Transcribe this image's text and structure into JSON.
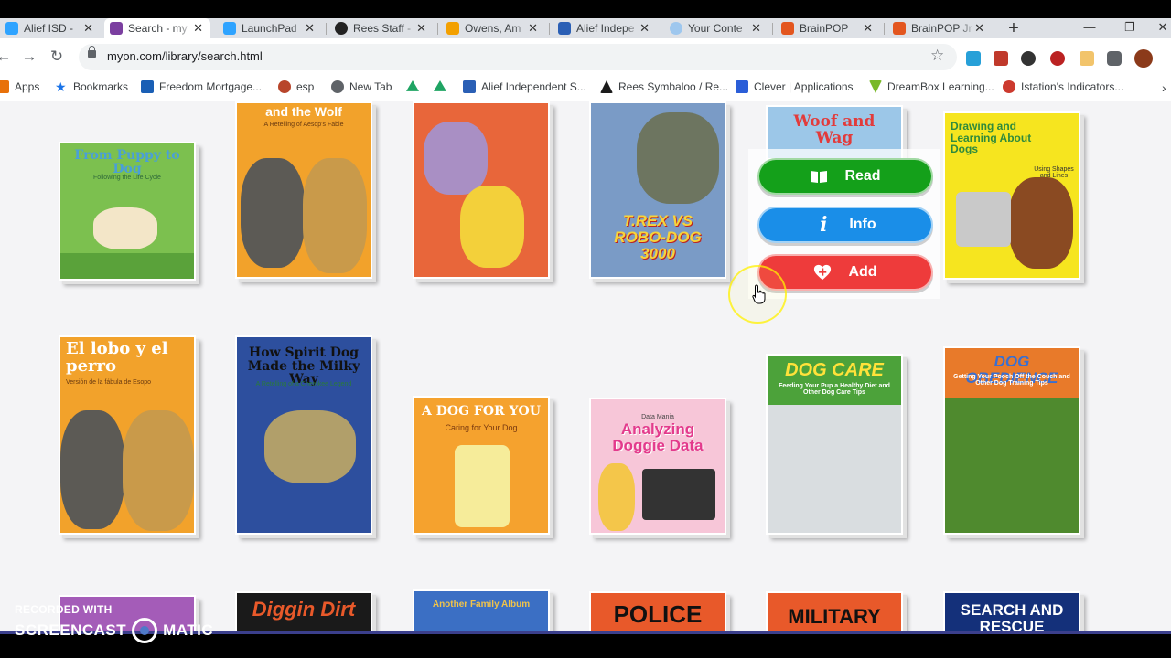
{
  "tabs": [
    {
      "title": "Alief ISD - ",
      "color": "#2ea3ff",
      "active": false
    },
    {
      "title": "Search - my",
      "color": "#7b3fa0",
      "active": true
    },
    {
      "title": "LaunchPad",
      "color": "#2ea3ff",
      "active": false
    },
    {
      "title": "Rees Staff -",
      "color": "#222222",
      "active": false
    },
    {
      "title": "Owens, Am",
      "color": "#f3a000",
      "active": false
    },
    {
      "title": "Alief Indepe",
      "color": "#2a5fb5",
      "active": false
    },
    {
      "title": "Your Conte",
      "color": "#9ec7ee",
      "active": false
    },
    {
      "title": "BrainPOP",
      "color": "#e3561f",
      "active": false
    },
    {
      "title": "BrainPOP Jr",
      "color": "#e3561f",
      "active": false
    }
  ],
  "address": {
    "url": "myon.com/library/search.html"
  },
  "bookmarks": [
    {
      "label": "Apps",
      "color": "#e8710a"
    },
    {
      "label": "Bookmarks",
      "color": "#1a73e8"
    },
    {
      "label": "Freedom Mortgage...",
      "color": "#1a5fb5"
    },
    {
      "label": "esp",
      "color": "#b8452b"
    },
    {
      "label": "New Tab",
      "color": "#5f6368"
    },
    {
      "label": "",
      "color": "#1fa463"
    },
    {
      "label": "Alief Independent S...",
      "color": "#2a5fb5"
    },
    {
      "label": "Rees Symbaloo / Re...",
      "color": "#1b1b1b"
    },
    {
      "label": "Clever | Applications",
      "color": "#2b5ed8"
    },
    {
      "label": "DreamBox Learning...",
      "color": "#79b928"
    },
    {
      "label": "Istation's Indicators...",
      "color": "#cc3a2e"
    }
  ],
  "books": [
    {
      "title": "From Puppy to Dog",
      "subtitle": "Following the Life Cycle",
      "bg": "#7cc04f",
      "tc": "#4a9fd8"
    },
    {
      "title": "and the Wolf",
      "subtitle": "A Retelling of Aesop's Fable",
      "bg": "#f2a22b",
      "tc": "#ffffff"
    },
    {
      "title": "",
      "subtitle": "",
      "bg": "#e8663a",
      "tc": "#ffffff"
    },
    {
      "title": "T.REX VS ROBO-DOG 3000",
      "subtitle": "",
      "bg": "#7a9bc6",
      "tc": "#f7d43a"
    },
    {
      "title": "Woof and Wag",
      "subtitle": "",
      "bg": "#9cc7e8",
      "tc": "#e23b3b"
    },
    {
      "title": "Drawing and Learning About Dogs",
      "subtitle": "Using Shapes and Lines",
      "bg": "#f6e51f",
      "tc": "#2f8a3c"
    },
    {
      "title": "El lobo y el perro",
      "subtitle": "Versión de la fábula de Esopo",
      "bg": "#f2a22b",
      "tc": "#ffffff"
    },
    {
      "title": "How Spirit Dog Made the Milky Way",
      "subtitle": "A Retelling of a Cherokee Legend",
      "bg": "#2d4f9e",
      "tc": "#111111"
    },
    {
      "title": "A DOG FOR YOU",
      "subtitle": "Caring for Your Dog",
      "bg": "#f5a22e",
      "tc": "#ffffff"
    },
    {
      "title": "Analyzing Doggie Data",
      "subtitle": "Data Mania",
      "bg": "#f7c6d8",
      "tc": "#e33a8c"
    },
    {
      "title": "DOG CARE",
      "subtitle": "Feeding Your Pup a Healthy Diet and Other Dog Care Tips",
      "bg": "#4ca23a",
      "tc": "#ffe23a"
    },
    {
      "title": "DOG OBEDIENCE",
      "subtitle": "Getting Your Pooch Off the Couch and Other Dog Training Tips",
      "bg": "#e87a2a",
      "tc": "#3a6fd0"
    },
    {
      "title": "",
      "subtitle": "",
      "bg": "#a45cb8",
      "tc": "#f7d43a"
    },
    {
      "title": "Diggin Dirt",
      "subtitle": "",
      "bg": "#1a1a1a",
      "tc": "#e8592a"
    },
    {
      "title": "Another Family Album",
      "subtitle": "",
      "bg": "#3b6fc4",
      "tc": "#f0c34a"
    },
    {
      "title": "POLICE",
      "subtitle": "",
      "bg": "#e8592a",
      "tc": "#111111"
    },
    {
      "title": "MILITARY",
      "subtitle": "",
      "bg": "#e8592a",
      "tc": "#111111"
    },
    {
      "title": "SEARCH AND RESCUE",
      "subtitle": "",
      "bg": "#14307a",
      "tc": "#ffffff"
    }
  ],
  "actions": {
    "read": {
      "label": "Read",
      "color": "#14a01a"
    },
    "info": {
      "label": "Info",
      "color": "#1a8ee8"
    },
    "add": {
      "label": "Add",
      "color": "#ee3b3b"
    }
  },
  "recorder": {
    "line1": "RECORDED WITH",
    "brand_left": "SCREENCAST",
    "brand_right": "MATIC"
  }
}
